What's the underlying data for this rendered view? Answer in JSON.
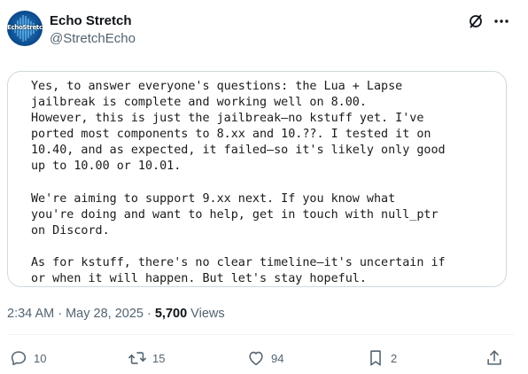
{
  "author": {
    "display_name": "Echo Stretch",
    "handle": "@StretchEcho",
    "avatar_text": "EchoStretch"
  },
  "header_icons": {
    "grok": "grok-slash-circle-icon",
    "more": "more-horizontal-icon"
  },
  "post": {
    "image_text": "Yes, to answer everyone's questions: the Lua + Lapse\njailbreak is complete and working well on 8.00.\nHowever, this is just the jailbreak—no kstuff yet. I've\nported most components to 8.xx and 10.??. I tested it on\n10.40, and as expected, it failed—so it's likely only good\nup to 10.00 or 10.01.\n\nWe're aiming to support 9.xx next. If you know what\nyou're doing and want to help, get in touch with null_ptr\non Discord.\n\nAs for kstuff, there's no clear timeline—it's uncertain if\nor when it will happen. But let's stay hopeful."
  },
  "meta": {
    "time": "2:34 AM",
    "sep1": " · ",
    "date": "May 28, 2025",
    "sep2": " · ",
    "views_count": "5,700",
    "views_label": " Views"
  },
  "actions": {
    "reply": {
      "icon": "reply-icon",
      "count": "10"
    },
    "repost": {
      "icon": "repost-icon",
      "count": "15"
    },
    "like": {
      "icon": "heart-icon",
      "count": "94"
    },
    "bookmark": {
      "icon": "bookmark-icon",
      "count": "2"
    },
    "share": {
      "icon": "share-icon"
    }
  },
  "colors": {
    "text_primary": "#0f1419",
    "text_secondary": "#536471",
    "border": "#cfd9de",
    "avatar_blue": "#0e4f93"
  }
}
